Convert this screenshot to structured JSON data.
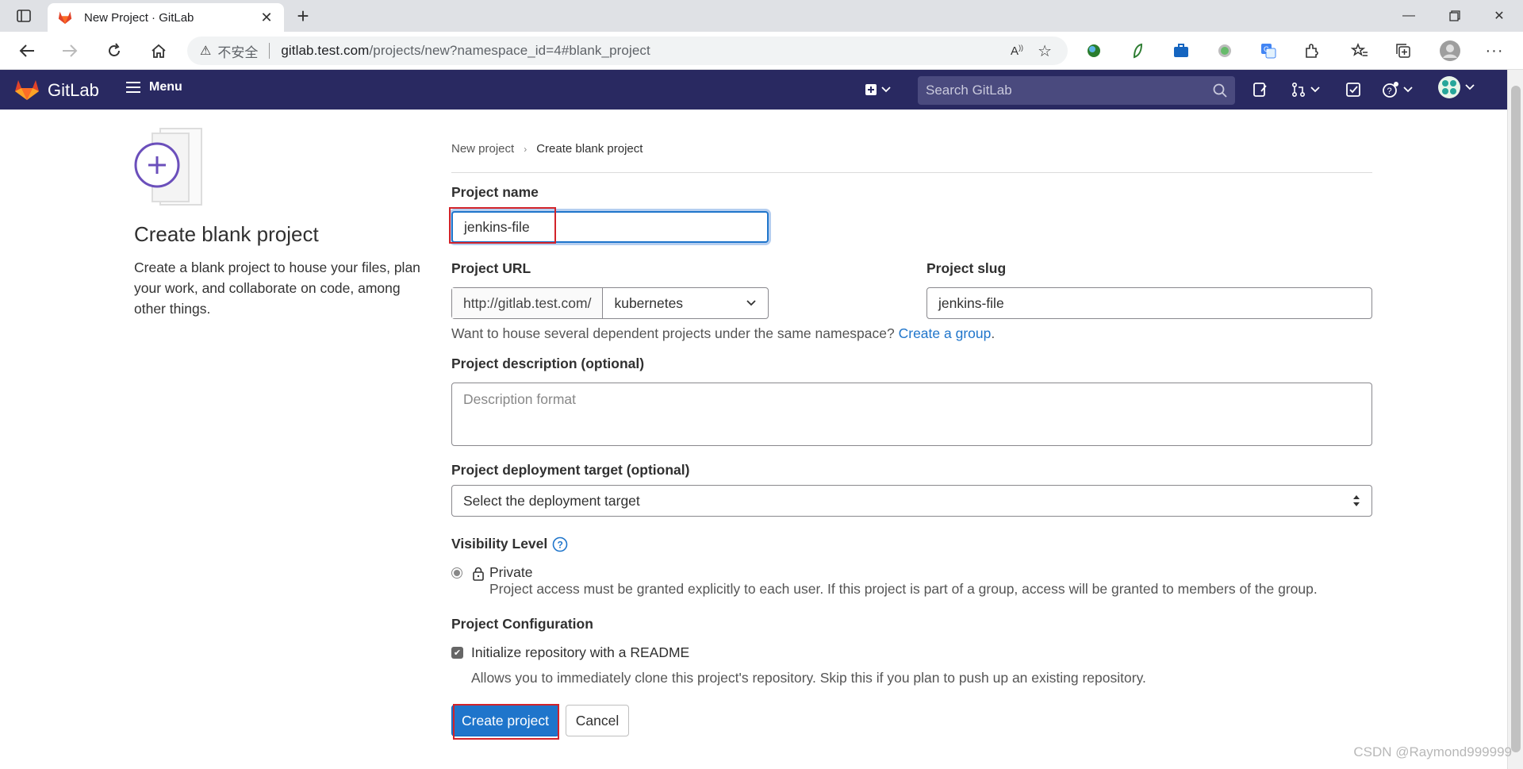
{
  "browser": {
    "tab_title": "New Project · GitLab",
    "security_label": "不安全",
    "url_host": "gitlab.test.com",
    "url_path": "/projects/new?namespace_id=4#blank_project"
  },
  "header": {
    "brand": "GitLab",
    "menu_label": "Menu",
    "search_placeholder": "Search GitLab",
    "colors": {
      "bar": "#292961",
      "accent": "#1f75cb"
    }
  },
  "intro": {
    "title": "Create blank project",
    "text": "Create a blank project to house your files, plan your work, and collaborate on code, among other things."
  },
  "breadcrumb": {
    "parent": "New project",
    "current": "Create blank project"
  },
  "form": {
    "project_name_label": "Project name",
    "project_name_value": "jenkins-file",
    "project_url_label": "Project URL",
    "url_prefix": "http://gitlab.test.com/",
    "namespace_value": "kubernetes",
    "project_slug_label": "Project slug",
    "project_slug_value": "jenkins-file",
    "namespace_hint": "Want to house several dependent projects under the same namespace?",
    "create_group_link": "Create a group",
    "description_label": "Project description (optional)",
    "description_placeholder": "Description format",
    "deploy_label": "Project deployment target (optional)",
    "deploy_value": "Select the deployment target",
    "visibility_label": "Visibility Level",
    "visibility_option": "Private",
    "visibility_desc": "Project access must be granted explicitly to each user. If this project is part of a group, access will be granted to members of the group.",
    "config_label": "Project Configuration",
    "readme_label": "Initialize repository with a README",
    "readme_desc": "Allows you to immediately clone this project's repository. Skip this if you plan to push up an existing repository.",
    "create_button": "Create project",
    "cancel_button": "Cancel"
  },
  "watermark": "CSDN @Raymond999999"
}
